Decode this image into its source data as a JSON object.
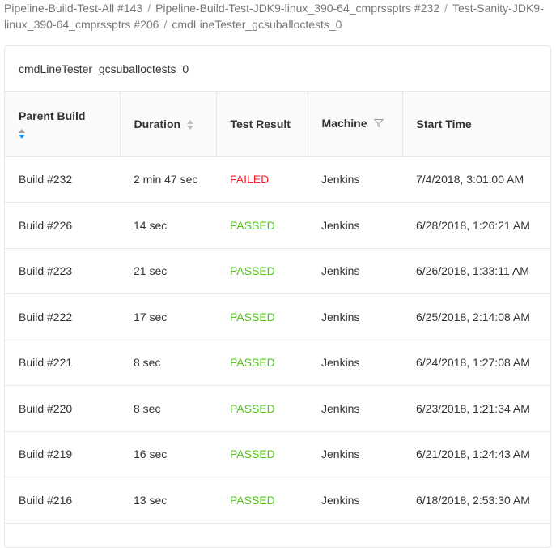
{
  "breadcrumb": {
    "items": [
      "Pipeline-Build-Test-All #143",
      "Pipeline-Build-Test-JDK9-linux_390-64_cmprssptrs  #232",
      "Test-Sanity-JDK9-linux_390-64_cmprssptrs #206",
      "cmdLineTester_gcsuballoctests_0"
    ],
    "separator": "/"
  },
  "card": {
    "title": "cmdLineTester_gcsuballoctests_0"
  },
  "table": {
    "headers": {
      "parent_build": "Parent Build",
      "duration": "Duration",
      "test_result": "Test Result",
      "machine": "Machine",
      "start_time": "Start Time"
    },
    "rows": [
      {
        "parent_build": "Build #232",
        "duration": "2 min 47 sec",
        "test_result": "FAILED",
        "machine": "Jenkins",
        "start_time": "7/4/2018, 3:01:00 AM"
      },
      {
        "parent_build": "Build #226",
        "duration": "14 sec",
        "test_result": "PASSED",
        "machine": "Jenkins",
        "start_time": "6/28/2018, 1:26:21 AM"
      },
      {
        "parent_build": "Build #223",
        "duration": "21 sec",
        "test_result": "PASSED",
        "machine": "Jenkins",
        "start_time": "6/26/2018, 1:33:11 AM"
      },
      {
        "parent_build": "Build #222",
        "duration": "17 sec",
        "test_result": "PASSED",
        "machine": "Jenkins",
        "start_time": "6/25/2018, 2:14:08 AM"
      },
      {
        "parent_build": "Build #221",
        "duration": "8 sec",
        "test_result": "PASSED",
        "machine": "Jenkins",
        "start_time": "6/24/2018, 1:27:08 AM"
      },
      {
        "parent_build": "Build #220",
        "duration": "8 sec",
        "test_result": "PASSED",
        "machine": "Jenkins",
        "start_time": "6/23/2018, 1:21:34 AM"
      },
      {
        "parent_build": "Build #219",
        "duration": "16 sec",
        "test_result": "PASSED",
        "machine": "Jenkins",
        "start_time": "6/21/2018, 1:24:43 AM"
      },
      {
        "parent_build": "Build #216",
        "duration": "13 sec",
        "test_result": "PASSED",
        "machine": "Jenkins",
        "start_time": "6/18/2018, 2:53:30 AM"
      }
    ]
  },
  "colors": {
    "failed": "#f5222d",
    "passed": "#52c41a",
    "sort_active": "#1890ff",
    "header_bg": "#fafafa",
    "border": "#e8e8e8"
  },
  "icons": {
    "sort": "sort-caret-icon",
    "filter": "filter-funnel-icon"
  }
}
